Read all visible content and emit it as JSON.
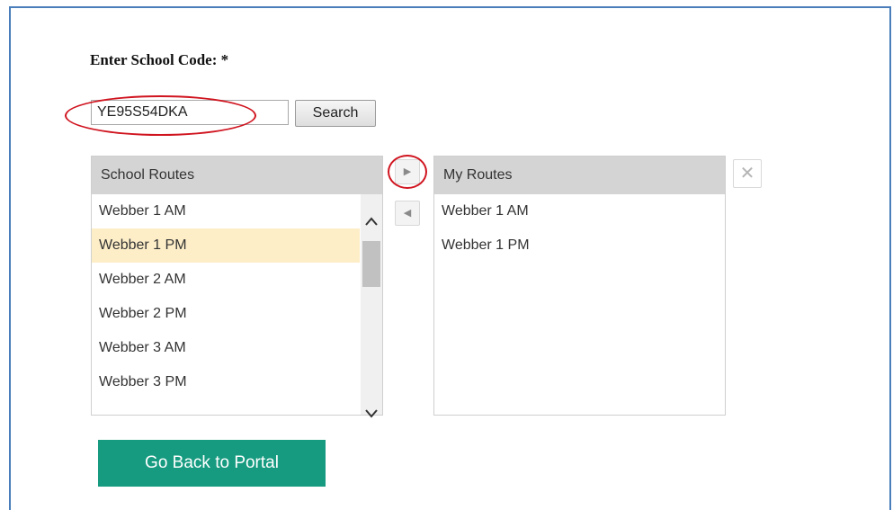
{
  "form": {
    "code_label": "Enter School Code: *",
    "code_value": "YE95S54DKA",
    "search_label": "Search"
  },
  "school_routes": {
    "header": "School Routes",
    "items": [
      "Webber 1 AM",
      "Webber 1 PM",
      "Webber 2 AM",
      "Webber 2 PM",
      "Webber 3 AM",
      "Webber 3 PM"
    ],
    "selected": "Webber 1 PM"
  },
  "transfer": {
    "add_icon": "triangle-right-icon",
    "remove_icon": "triangle-left-icon",
    "add_glyph": "▶",
    "remove_glyph": "◀"
  },
  "my_routes": {
    "header": "My Routes",
    "items": [
      "Webber 1 AM",
      "Webber 1 PM"
    ],
    "clear_glyph": "✕"
  },
  "footer": {
    "portal_label": "Go Back to Portal"
  },
  "colors": {
    "annotation": "#d0141f",
    "portal_button": "#169b80",
    "selected_row": "#fdeec8",
    "frame_border": "#4a7ebb"
  }
}
